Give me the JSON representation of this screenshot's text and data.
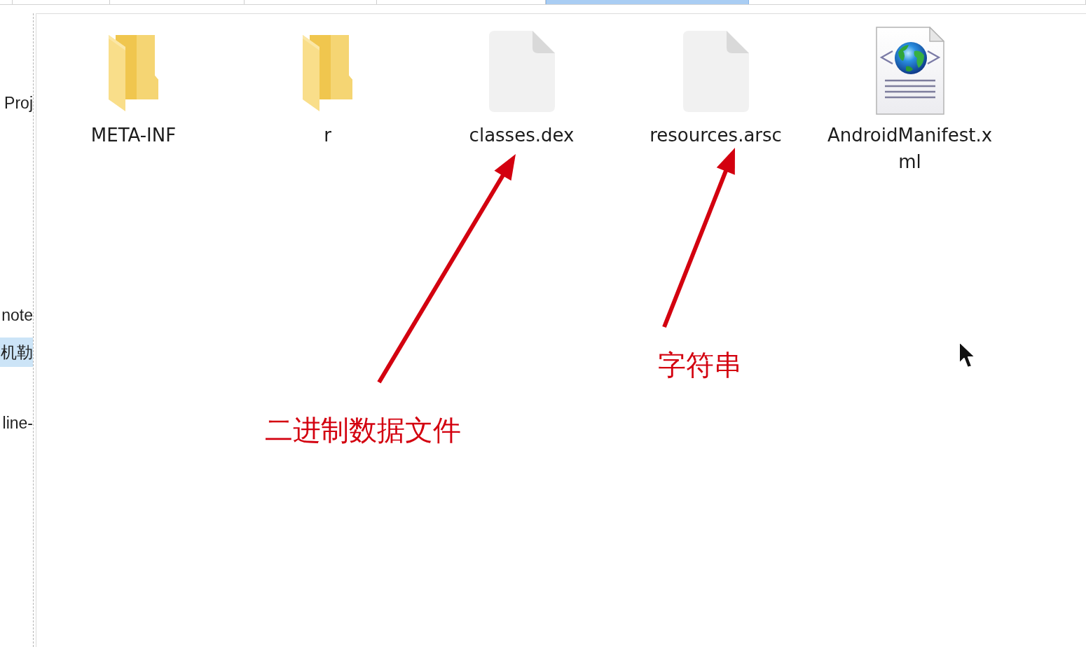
{
  "tab_strip": {
    "tabs": [
      {
        "selected": false
      },
      {
        "selected": false
      },
      {
        "selected": false
      },
      {
        "selected": false
      },
      {
        "selected": false
      },
      {
        "selected": true
      },
      {
        "selected": false
      }
    ]
  },
  "sidebar": {
    "items": [
      {
        "label": "Proj",
        "selected": false
      },
      {
        "label": "note",
        "selected": false
      },
      {
        "label": "机勒",
        "selected": true
      },
      {
        "label": "line-",
        "selected": false
      }
    ]
  },
  "files": [
    {
      "name": "META-INF",
      "kind": "folder"
    },
    {
      "name": "r",
      "kind": "folder"
    },
    {
      "name": "classes.dex",
      "kind": "file"
    },
    {
      "name": "resources.arsc",
      "kind": "file"
    },
    {
      "name": "AndroidManifest.xml",
      "kind": "xml"
    }
  ],
  "annotations": [
    {
      "text": "二进制数据文件"
    },
    {
      "text": "字符串"
    }
  ]
}
